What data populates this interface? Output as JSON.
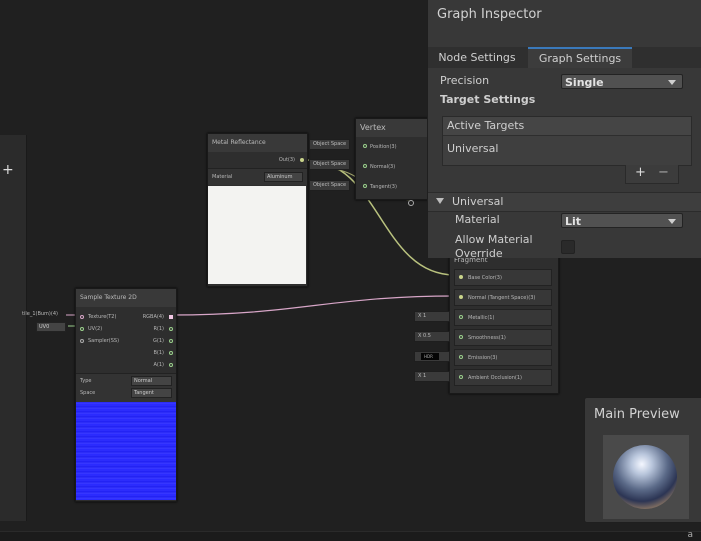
{
  "graph": {
    "blackboard": {
      "add_label": "+"
    },
    "metal_node": {
      "title": "Metal Reflectance",
      "output_label": "Out(3)",
      "material_label": "Material",
      "material_value": "Aluminum"
    },
    "vertex_node": {
      "title": "Vertex",
      "ports": [
        {
          "space": "Object Space",
          "label": "Position(3)"
        },
        {
          "space": "Object Space",
          "label": "Normal(3)"
        },
        {
          "space": "Object Space",
          "label": "Tangent(3)"
        }
      ]
    },
    "fragment_node": {
      "title": "Fragment",
      "ports": [
        {
          "input_prefix": "",
          "input_value": "",
          "label": "Base Color(3)"
        },
        {
          "input_prefix": "",
          "input_value": "",
          "label": "Normal (Tangent Space)(3)"
        },
        {
          "input_prefix": "X",
          "input_value": "1",
          "label": "Metallic(1)"
        },
        {
          "input_prefix": "X",
          "input_value": "0.5",
          "label": "Smoothness(1)"
        },
        {
          "input_prefix": "",
          "input_value": "HDR",
          "label": "Emission(3)"
        },
        {
          "input_prefix": "X",
          "input_value": "1",
          "label": "Ambient Occlusion(1)"
        }
      ]
    },
    "sample_node": {
      "title": "Sample Texture 2D",
      "inputs": [
        "Texture(T2)",
        "UV(2)",
        "Sampler(SS)"
      ],
      "outputs": [
        "RGBA(4)",
        "R(1)",
        "G(1)",
        "B(1)",
        "A(1)"
      ],
      "texture_input_label": "tile_1(Bum)(4)",
      "uv_input_label": "UV0",
      "type_label": "Type",
      "type_value": "Normal",
      "space_label": "Space",
      "space_value": "Tangent"
    }
  },
  "inspector": {
    "title": "Graph Inspector",
    "tabs": [
      {
        "label": "Node Settings"
      },
      {
        "label": "Graph Settings"
      }
    ],
    "precision_label": "Precision",
    "precision_value": "Single",
    "target_settings_label": "Target Settings",
    "active_targets_label": "Active Targets",
    "targets": [
      "Universal"
    ],
    "add_label": "+",
    "remove_label": "−",
    "section_label": "Universal",
    "material_label": "Material",
    "material_value": "Lit",
    "allow_override_label": "Allow Material Override"
  },
  "preview": {
    "title": "Main Preview"
  },
  "status": {
    "icon_label": "a"
  },
  "colors": {
    "accent_tab": "#3a79bb",
    "wire_vector3": "#c8d38a",
    "wire_vector4": "#d8a6c8",
    "texture_preview": "#2f2fff"
  }
}
